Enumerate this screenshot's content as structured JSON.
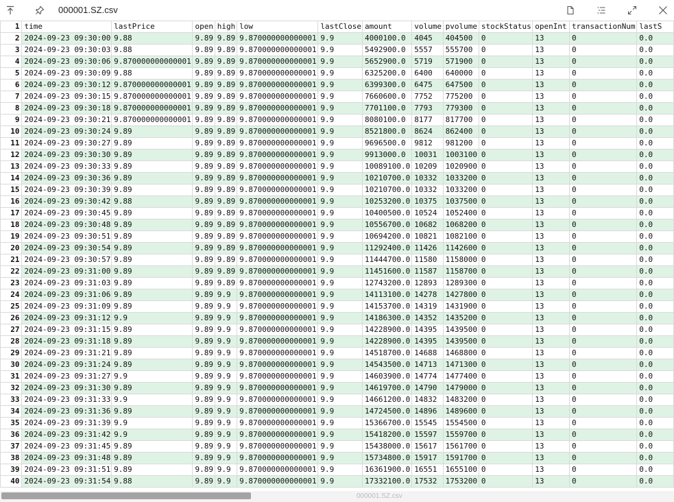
{
  "window": {
    "title": "000001.SZ.csv"
  },
  "status": {
    "filename": "000001.SZ.csv"
  },
  "columns": [
    "time",
    "lastPrice",
    "open",
    "high",
    "low",
    "lastClose",
    "amount",
    "volume",
    "pvolume",
    "stockStatus",
    "openInt",
    "transactionNum",
    "lastS"
  ],
  "rows": [
    [
      "2024-09-23 09:30:00",
      "9.88",
      "9.89",
      "9.89",
      "9.870000000000001",
      "9.9",
      "4000100.0",
      "4045",
      "404500",
      "0",
      "13",
      "0",
      "0.0"
    ],
    [
      "2024-09-23 09:30:03",
      "9.88",
      "9.89",
      "9.89",
      "9.870000000000001",
      "9.9",
      "5492900.0",
      "5557",
      "555700",
      "0",
      "13",
      "0",
      "0.0"
    ],
    [
      "2024-09-23 09:30:06",
      "9.870000000000001",
      "9.89",
      "9.89",
      "9.870000000000001",
      "9.9",
      "5652900.0",
      "5719",
      "571900",
      "0",
      "13",
      "0",
      "0.0"
    ],
    [
      "2024-09-23 09:30:09",
      "9.88",
      "9.89",
      "9.89",
      "9.870000000000001",
      "9.9",
      "6325200.0",
      "6400",
      "640000",
      "0",
      "13",
      "0",
      "0.0"
    ],
    [
      "2024-09-23 09:30:12",
      "9.870000000000001",
      "9.89",
      "9.89",
      "9.870000000000001",
      "9.9",
      "6399300.0",
      "6475",
      "647500",
      "0",
      "13",
      "0",
      "0.0"
    ],
    [
      "2024-09-23 09:30:15",
      "9.870000000000001",
      "9.89",
      "9.89",
      "9.870000000000001",
      "9.9",
      "7660600.0",
      "7752",
      "775200",
      "0",
      "13",
      "0",
      "0.0"
    ],
    [
      "2024-09-23 09:30:18",
      "9.870000000000001",
      "9.89",
      "9.89",
      "9.870000000000001",
      "9.9",
      "7701100.0",
      "7793",
      "779300",
      "0",
      "13",
      "0",
      "0.0"
    ],
    [
      "2024-09-23 09:30:21",
      "9.870000000000001",
      "9.89",
      "9.89",
      "9.870000000000001",
      "9.9",
      "8080100.0",
      "8177",
      "817700",
      "0",
      "13",
      "0",
      "0.0"
    ],
    [
      "2024-09-23 09:30:24",
      "9.89",
      "9.89",
      "9.89",
      "9.870000000000001",
      "9.9",
      "8521800.0",
      "8624",
      "862400",
      "0",
      "13",
      "0",
      "0.0"
    ],
    [
      "2024-09-23 09:30:27",
      "9.89",
      "9.89",
      "9.89",
      "9.870000000000001",
      "9.9",
      "9696500.0",
      "9812",
      "981200",
      "0",
      "13",
      "0",
      "0.0"
    ],
    [
      "2024-09-23 09:30:30",
      "9.89",
      "9.89",
      "9.89",
      "9.870000000000001",
      "9.9",
      "9913000.0",
      "10031",
      "1003100",
      "0",
      "13",
      "0",
      "0.0"
    ],
    [
      "2024-09-23 09:30:33",
      "9.89",
      "9.89",
      "9.89",
      "9.870000000000001",
      "9.9",
      "10089100.0",
      "10209",
      "1020900",
      "0",
      "13",
      "0",
      "0.0"
    ],
    [
      "2024-09-23 09:30:36",
      "9.89",
      "9.89",
      "9.89",
      "9.870000000000001",
      "9.9",
      "10210700.0",
      "10332",
      "1033200",
      "0",
      "13",
      "0",
      "0.0"
    ],
    [
      "2024-09-23 09:30:39",
      "9.89",
      "9.89",
      "9.89",
      "9.870000000000001",
      "9.9",
      "10210700.0",
      "10332",
      "1033200",
      "0",
      "13",
      "0",
      "0.0"
    ],
    [
      "2024-09-23 09:30:42",
      "9.88",
      "9.89",
      "9.89",
      "9.870000000000001",
      "9.9",
      "10253200.0",
      "10375",
      "1037500",
      "0",
      "13",
      "0",
      "0.0"
    ],
    [
      "2024-09-23 09:30:45",
      "9.89",
      "9.89",
      "9.89",
      "9.870000000000001",
      "9.9",
      "10400500.0",
      "10524",
      "1052400",
      "0",
      "13",
      "0",
      "0.0"
    ],
    [
      "2024-09-23 09:30:48",
      "9.89",
      "9.89",
      "9.89",
      "9.870000000000001",
      "9.9",
      "10556700.0",
      "10682",
      "1068200",
      "0",
      "13",
      "0",
      "0.0"
    ],
    [
      "2024-09-23 09:30:51",
      "9.89",
      "9.89",
      "9.89",
      "9.870000000000001",
      "9.9",
      "10694200.0",
      "10821",
      "1082100",
      "0",
      "13",
      "0",
      "0.0"
    ],
    [
      "2024-09-23 09:30:54",
      "9.89",
      "9.89",
      "9.89",
      "9.870000000000001",
      "9.9",
      "11292400.0",
      "11426",
      "1142600",
      "0",
      "13",
      "0",
      "0.0"
    ],
    [
      "2024-09-23 09:30:57",
      "9.89",
      "9.89",
      "9.89",
      "9.870000000000001",
      "9.9",
      "11444700.0",
      "11580",
      "1158000",
      "0",
      "13",
      "0",
      "0.0"
    ],
    [
      "2024-09-23 09:31:00",
      "9.89",
      "9.89",
      "9.89",
      "9.870000000000001",
      "9.9",
      "11451600.0",
      "11587",
      "1158700",
      "0",
      "13",
      "0",
      "0.0"
    ],
    [
      "2024-09-23 09:31:03",
      "9.89",
      "9.89",
      "9.89",
      "9.870000000000001",
      "9.9",
      "12743200.0",
      "12893",
      "1289300",
      "0",
      "13",
      "0",
      "0.0"
    ],
    [
      "2024-09-23 09:31:06",
      "9.89",
      "9.89",
      "9.9",
      "9.870000000000001",
      "9.9",
      "14113100.0",
      "14278",
      "1427800",
      "0",
      "13",
      "0",
      "0.0"
    ],
    [
      "2024-09-23 09:31:09",
      "9.89",
      "9.89",
      "9.9",
      "9.870000000000001",
      "9.9",
      "14153700.0",
      "14319",
      "1431900",
      "0",
      "13",
      "0",
      "0.0"
    ],
    [
      "2024-09-23 09:31:12",
      "9.9",
      "9.89",
      "9.9",
      "9.870000000000001",
      "9.9",
      "14186300.0",
      "14352",
      "1435200",
      "0",
      "13",
      "0",
      "0.0"
    ],
    [
      "2024-09-23 09:31:15",
      "9.89",
      "9.89",
      "9.9",
      "9.870000000000001",
      "9.9",
      "14228900.0",
      "14395",
      "1439500",
      "0",
      "13",
      "0",
      "0.0"
    ],
    [
      "2024-09-23 09:31:18",
      "9.89",
      "9.89",
      "9.9",
      "9.870000000000001",
      "9.9",
      "14228900.0",
      "14395",
      "1439500",
      "0",
      "13",
      "0",
      "0.0"
    ],
    [
      "2024-09-23 09:31:21",
      "9.89",
      "9.89",
      "9.9",
      "9.870000000000001",
      "9.9",
      "14518700.0",
      "14688",
      "1468800",
      "0",
      "13",
      "0",
      "0.0"
    ],
    [
      "2024-09-23 09:31:24",
      "9.89",
      "9.89",
      "9.9",
      "9.870000000000001",
      "9.9",
      "14543500.0",
      "14713",
      "1471300",
      "0",
      "13",
      "0",
      "0.0"
    ],
    [
      "2024-09-23 09:31:27",
      "9.9",
      "9.89",
      "9.9",
      "9.870000000000001",
      "9.9",
      "14603900.0",
      "14774",
      "1477400",
      "0",
      "13",
      "0",
      "0.0"
    ],
    [
      "2024-09-23 09:31:30",
      "9.89",
      "9.89",
      "9.9",
      "9.870000000000001",
      "9.9",
      "14619700.0",
      "14790",
      "1479000",
      "0",
      "13",
      "0",
      "0.0"
    ],
    [
      "2024-09-23 09:31:33",
      "9.9",
      "9.89",
      "9.9",
      "9.870000000000001",
      "9.9",
      "14661200.0",
      "14832",
      "1483200",
      "0",
      "13",
      "0",
      "0.0"
    ],
    [
      "2024-09-23 09:31:36",
      "9.89",
      "9.89",
      "9.9",
      "9.870000000000001",
      "9.9",
      "14724500.0",
      "14896",
      "1489600",
      "0",
      "13",
      "0",
      "0.0"
    ],
    [
      "2024-09-23 09:31:39",
      "9.9",
      "9.89",
      "9.9",
      "9.870000000000001",
      "9.9",
      "15366700.0",
      "15545",
      "1554500",
      "0",
      "13",
      "0",
      "0.0"
    ],
    [
      "2024-09-23 09:31:42",
      "9.9",
      "9.89",
      "9.9",
      "9.870000000000001",
      "9.9",
      "15418200.0",
      "15597",
      "1559700",
      "0",
      "13",
      "0",
      "0.0"
    ],
    [
      "2024-09-23 09:31:45",
      "9.89",
      "9.89",
      "9.9",
      "9.870000000000001",
      "9.9",
      "15438000.0",
      "15617",
      "1561700",
      "0",
      "13",
      "0",
      "0.0"
    ],
    [
      "2024-09-23 09:31:48",
      "9.89",
      "9.89",
      "9.9",
      "9.870000000000001",
      "9.9",
      "15734800.0",
      "15917",
      "1591700",
      "0",
      "13",
      "0",
      "0.0"
    ],
    [
      "2024-09-23 09:31:51",
      "9.89",
      "9.89",
      "9.9",
      "9.870000000000001",
      "9.9",
      "16361900.0",
      "16551",
      "1655100",
      "0",
      "13",
      "0",
      "0.0"
    ],
    [
      "2024-09-23 09:31:54",
      "9.88",
      "9.89",
      "9.9",
      "9.870000000000001",
      "9.9",
      "17332100.0",
      "17532",
      "1753200",
      "0",
      "13",
      "0",
      "0.0"
    ]
  ],
  "icons": {
    "pin-top": "arrow-to-top-icon",
    "pin": "pushpin-icon",
    "new-file": "new-file-icon",
    "format": "format-list-icon",
    "expand": "expand-icon",
    "close": "close-icon"
  }
}
